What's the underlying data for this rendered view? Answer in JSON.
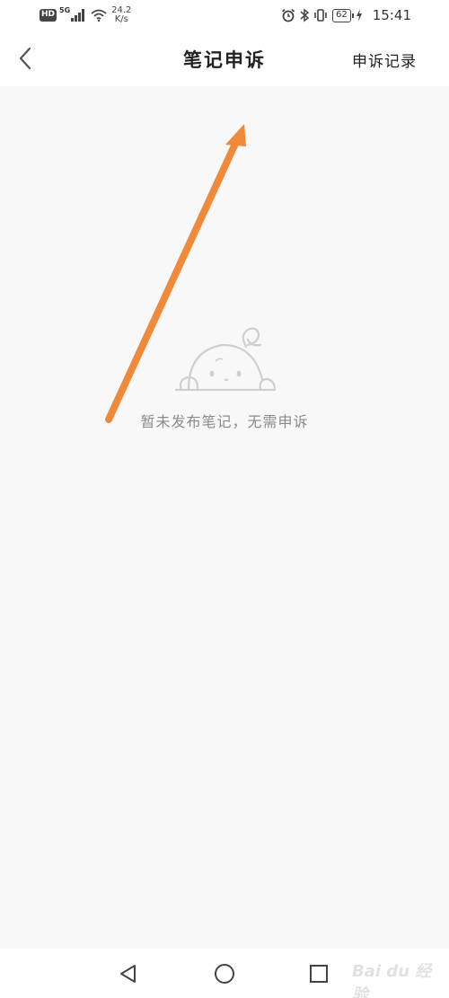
{
  "status_bar": {
    "hd": "HD",
    "network_type": "5G",
    "net_speed_value": "24.2",
    "net_speed_unit": "K/s",
    "battery": "62",
    "time": "15:41"
  },
  "header": {
    "title": "笔记申诉",
    "records_label": "申诉记录"
  },
  "empty_state": {
    "message": "暂未发布笔记，无需申诉"
  },
  "annotation": {
    "arrow_color": "#f08a3a"
  },
  "watermark": {
    "text": "Bai du 经验"
  }
}
